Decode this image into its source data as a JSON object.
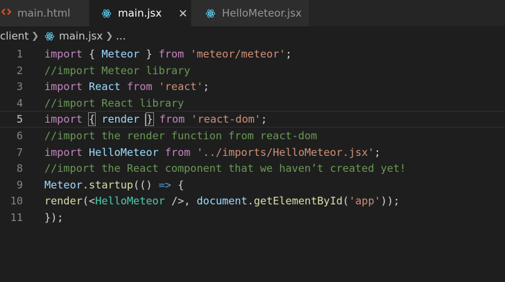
{
  "colors": {
    "html_icon": "#e44d26",
    "react_icon": "#61dafb",
    "keyword": "#c586c0",
    "variable": "#9cdcfe",
    "string": "#ce9178",
    "comment": "#6a9955",
    "function": "#dcdcaa",
    "component": "#4ec9b0"
  },
  "tabs": [
    {
      "label": "main.html",
      "icon": "html-icon",
      "active": false
    },
    {
      "label": "main.jsx",
      "icon": "react-icon",
      "active": true,
      "close": "✕"
    },
    {
      "label": "HelloMeteor.jsx",
      "icon": "react-icon",
      "active": false
    }
  ],
  "breadcrumb": {
    "folder": "client",
    "file": "main.jsx",
    "more": "..."
  },
  "editor": {
    "current_line": 5,
    "lines": [
      {
        "n": "1",
        "tokens": [
          [
            "kw",
            "import"
          ],
          [
            "pl",
            " { "
          ],
          [
            "id",
            "Meteor"
          ],
          [
            "pl",
            " } "
          ],
          [
            "kw",
            "from"
          ],
          [
            "pl",
            " "
          ],
          [
            "str",
            "'meteor/meteor'"
          ],
          [
            "pl",
            ";"
          ]
        ]
      },
      {
        "n": "2",
        "tokens": [
          [
            "cm",
            "//import Meteor library"
          ]
        ]
      },
      {
        "n": "3",
        "tokens": [
          [
            "kw",
            "import"
          ],
          [
            "pl",
            " "
          ],
          [
            "id",
            "React"
          ],
          [
            "pl",
            " "
          ],
          [
            "kw",
            "from"
          ],
          [
            "pl",
            " "
          ],
          [
            "str",
            "'react'"
          ],
          [
            "pl",
            ";"
          ]
        ]
      },
      {
        "n": "4",
        "tokens": [
          [
            "cm",
            "//import React library"
          ]
        ]
      },
      {
        "n": "5",
        "tokens": [
          [
            "kw",
            "import"
          ],
          [
            "pl",
            " "
          ],
          [
            "pl",
            "{"
          ],
          [
            "pl",
            " "
          ],
          [
            "id",
            "render"
          ],
          [
            "pl",
            " "
          ],
          [
            "pl",
            "}"
          ],
          [
            "pl",
            " "
          ],
          [
            "kw",
            "from"
          ],
          [
            "pl",
            " "
          ],
          [
            "str",
            "'react-dom'"
          ],
          [
            "pl",
            ";"
          ]
        ]
      },
      {
        "n": "6",
        "tokens": [
          [
            "cm",
            "//import the render function from react-dom"
          ]
        ]
      },
      {
        "n": "7",
        "tokens": [
          [
            "kw",
            "import"
          ],
          [
            "pl",
            " "
          ],
          [
            "id",
            "HelloMeteor"
          ],
          [
            "pl",
            " "
          ],
          [
            "kw",
            "from"
          ],
          [
            "pl",
            " "
          ],
          [
            "str",
            "'../imports/HelloMeteor.jsx'"
          ],
          [
            "pl",
            ";"
          ]
        ]
      },
      {
        "n": "8",
        "tokens": [
          [
            "cm",
            "//import the React component that we haven’t created yet!"
          ]
        ]
      },
      {
        "n": "9",
        "tokens": [
          [
            "id",
            "Meteor"
          ],
          [
            "pl",
            "."
          ],
          [
            "fn",
            "startup"
          ],
          [
            "pl",
            "(() "
          ],
          [
            "bl",
            "=>"
          ],
          [
            "pl",
            " {"
          ]
        ]
      },
      {
        "n": "10",
        "tokens": [
          [
            "fn",
            "render"
          ],
          [
            "pl",
            "("
          ],
          [
            "pl",
            "<"
          ],
          [
            "tag",
            "HelloMeteor"
          ],
          [
            "pl",
            " "
          ],
          [
            "pl",
            "/>"
          ],
          [
            "pl",
            ", "
          ],
          [
            "id",
            "document"
          ],
          [
            "pl",
            "."
          ],
          [
            "fn",
            "getElementById"
          ],
          [
            "pl",
            "("
          ],
          [
            "str",
            "'app'"
          ],
          [
            "pl",
            "));"
          ]
        ]
      },
      {
        "n": "11",
        "tokens": [
          [
            "pl",
            "});"
          ]
        ]
      }
    ]
  }
}
